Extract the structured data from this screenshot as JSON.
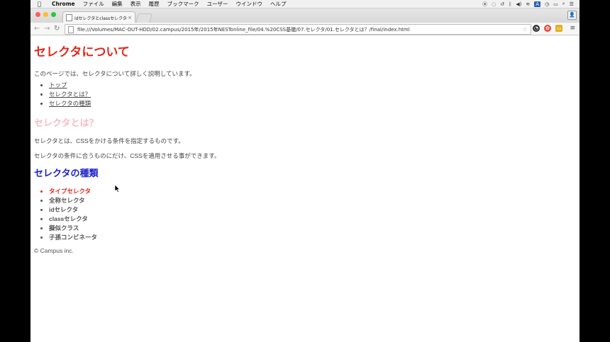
{
  "menubar": {
    "app": "Chrome",
    "items": [
      "ファイル",
      "編集",
      "表示",
      "履歴",
      "ブックマーク",
      "ユーザー",
      "ウインドウ",
      "ヘルプ"
    ],
    "status_icons": [
      "record-icon",
      "sync-icon",
      "history-icon",
      "bluetooth-icon",
      "volume-icon",
      "wifi-icon",
      "input-a-icon",
      "clock-icon",
      "battery-icon",
      "search-icon",
      "list-icon"
    ]
  },
  "tab": {
    "title": "idセレクタとclassセレクタ"
  },
  "toolbar": {
    "url": "file:///Volumes/MAC-OUT-HDD/02.campus/2015年/2015年NESTonline_file/04.%20CSS基礎/07.セレクタ/01.セレクタとは？/final/index.html"
  },
  "page": {
    "title": "セレクタについて",
    "intro": "このページでは、セレクタについて詳しく説明しています。",
    "nav": [
      "トップ",
      "セレクタとは？",
      "セレクタの種類"
    ],
    "section1": {
      "heading": "セレクタとは？",
      "paragraphs": [
        "セレクタとは、CSSをかける条件を指定するものです。",
        "セレクタの条件に合うものにだけ、CSSを適用させる事ができます。"
      ]
    },
    "section2": {
      "heading": "セレクタの種類",
      "items": [
        "タイプセレクタ",
        "全称セレクタ",
        "idセレクタ",
        "classセレクタ",
        "擬似クラス",
        "子孫コンビネータ"
      ],
      "highlighted_index": 0
    },
    "footer": "© Campus inc."
  },
  "colors": {
    "title_red": "#e0281c",
    "heading_pink": "#f5bcc6",
    "heading_blue": "#1b21c8"
  }
}
